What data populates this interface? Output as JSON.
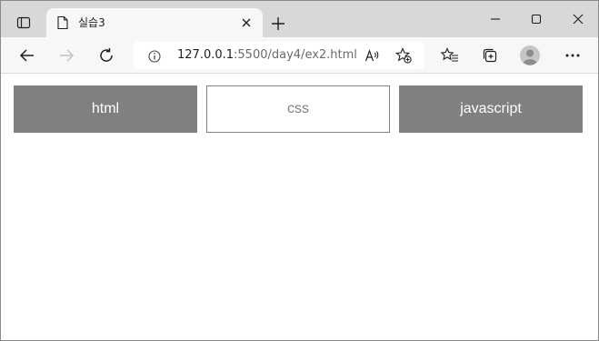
{
  "browser": {
    "tab": {
      "title": "실습3",
      "favicon": "page-icon"
    },
    "address": {
      "host": "127.0.0.1",
      "path": ":5500/day4/ex2.html"
    },
    "icons": {
      "tab_actions": "tab-actions-icon",
      "close_tab": "close-icon",
      "new_tab": "plus-icon",
      "minimize": "minimize-icon",
      "maximize": "maximize-icon",
      "close_window": "close-icon",
      "back": "back-arrow-icon",
      "forward": "forward-arrow-icon",
      "refresh": "refresh-icon",
      "site_info": "info-icon",
      "read_aloud": "read-aloud-icon",
      "add_favorite": "star-plus-icon",
      "favorites": "favorites-icon",
      "collections": "collections-icon",
      "profile": "avatar",
      "more": "more-icon"
    }
  },
  "page": {
    "boxes": [
      {
        "label": "html",
        "style": "filled"
      },
      {
        "label": "css",
        "style": "outlined"
      },
      {
        "label": "javascript",
        "style": "filled"
      }
    ]
  },
  "colors": {
    "tabstrip": "#d8d8d8",
    "toolbar": "#f7f7f7",
    "box_fill": "#808080",
    "box_text_filled": "#ffffff",
    "box_text_outlined": "#808080"
  }
}
